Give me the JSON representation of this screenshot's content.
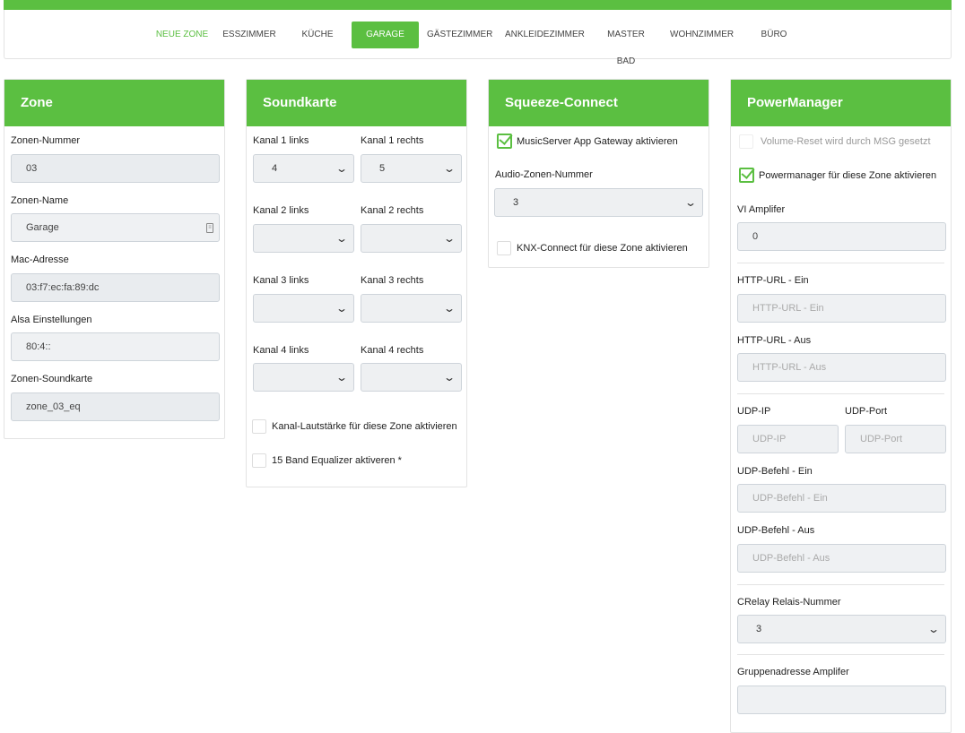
{
  "nav": {
    "items": [
      "NEUE ZONE",
      "ESSZIMMER",
      "KÜCHE",
      "GARAGE",
      "GÄSTEZIMMER",
      "ANKLEIDEZIMMER",
      "MASTER BAD",
      "WOHNZIMMER",
      "BÜRO"
    ],
    "active": "GARAGE"
  },
  "zone": {
    "title": "Zone",
    "fields": [
      {
        "label": "Zonen-Nummer",
        "value": "03"
      },
      {
        "label": "Zonen-Name",
        "value": "Garage"
      },
      {
        "label": "Mac-Adresse",
        "value": "03:f7:ec:fa:89:dc"
      },
      {
        "label": "Alsa Einstellungen",
        "value": "80:4::"
      },
      {
        "label": "Zonen-Soundkarte",
        "value": "zone_03_eq"
      }
    ]
  },
  "sound": {
    "title": "Soundkarte",
    "channels": [
      {
        "left_label": "Kanal 1 links",
        "left": "4",
        "right_label": "Kanal 1 rechts",
        "right": "5"
      },
      {
        "left_label": "Kanal 2 links",
        "left": "",
        "right_label": "Kanal 2 rechts",
        "right": ""
      },
      {
        "left_label": "Kanal 3 links",
        "left": "",
        "right_label": "Kanal 3 rechts",
        "right": ""
      },
      {
        "left_label": "Kanal 4 links",
        "left": "",
        "right_label": "Kanal 4 rechts",
        "right": ""
      }
    ],
    "cb_volume": "Kanal-Lautstärke für diese Zone aktivieren",
    "cb_eq": "15 Band Equalizer aktiveren *"
  },
  "squeeze": {
    "title": "Squeeze-Connect",
    "cb_gateway": "MusicServer App Gateway aktivieren",
    "audio_label": "Audio-Zonen-Nummer",
    "audio_value": "3",
    "cb_knx": "KNX-Connect für diese Zone aktivieren"
  },
  "power": {
    "title": "PowerManager",
    "cb_reset": "Volume-Reset wird durch MSG gesetzt",
    "cb_pm": "Powermanager für diese Zone aktivieren",
    "vi_label": "VI Amplifer",
    "vi_value": "0",
    "http_on_label": "HTTP-URL - Ein",
    "http_on_ph": "HTTP-URL - Ein",
    "http_off_label": "HTTP-URL - Aus",
    "http_off_ph": "HTTP-URL - Aus",
    "udp_ip_label": "UDP-IP",
    "udp_ip_ph": "UDP-IP",
    "udp_port_label": "UDP-Port",
    "udp_port_ph": "UDP-Port",
    "udp_on_label": "UDP-Befehl - Ein",
    "udp_on_ph": "UDP-Befehl - Ein",
    "udp_off_label": "UDP-Befehl - Aus",
    "udp_off_ph": "UDP-Befehl - Aus",
    "crelay_label": "CRelay Relais-Nummer",
    "crelay_value": "3",
    "group_label": "Gruppenadresse Amplifer",
    "group_value": ""
  }
}
